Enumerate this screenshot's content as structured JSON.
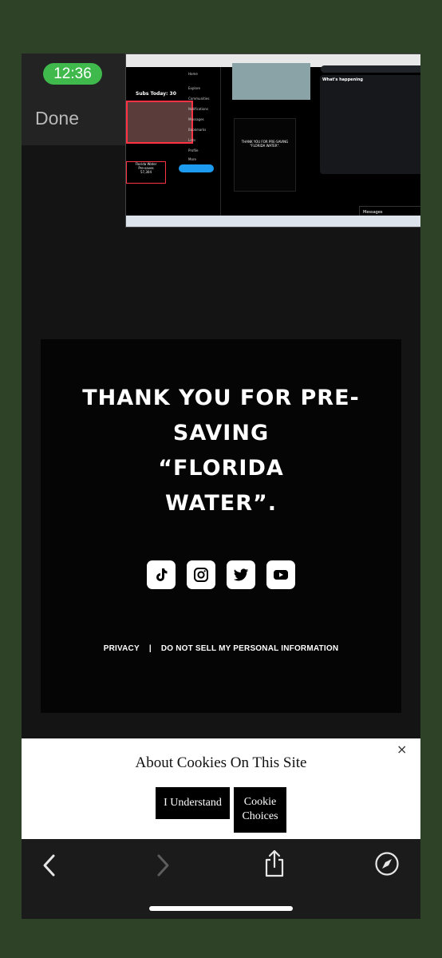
{
  "status": {
    "time": "12:36"
  },
  "header": {
    "done_label": "Done"
  },
  "pip": {
    "subs_text": "Subs Today: 30",
    "nav_items": [
      "Home",
      "Explore",
      "Communities",
      "Notifications",
      "Messages",
      "Bookmarks",
      "Lists",
      "Profile",
      "More"
    ],
    "box_title": "Florida Water",
    "box_sub": "Pre-saves",
    "box_count": "57,304",
    "post_text": "THANK YOU FOR PRE-SAVING \"FLORIDA WATER\".",
    "right_title": "What's happening",
    "messages_label": "Messages"
  },
  "main": {
    "headline_lines": [
      "THANK YOU FOR PRE-",
      "SAVING",
      "“FLORIDA",
      "WATER”."
    ],
    "social": [
      {
        "name": "tiktok-icon"
      },
      {
        "name": "instagram-icon"
      },
      {
        "name": "twitter-icon"
      },
      {
        "name": "youtube-icon"
      }
    ],
    "links": {
      "privacy": "PRIVACY",
      "separator": "|",
      "do_not_sell": "DO NOT SELL MY PERSONAL INFORMATION"
    }
  },
  "cookie": {
    "title": "About Cookies On This Site",
    "close": "×",
    "understand_label": "I Understand",
    "choices_line1": "Cookie",
    "choices_line2": "Choices"
  },
  "colors": {
    "status_pill": "#3fb94c",
    "outer_bg": "#2d4226",
    "twitter_blue": "#1d9bf0"
  }
}
